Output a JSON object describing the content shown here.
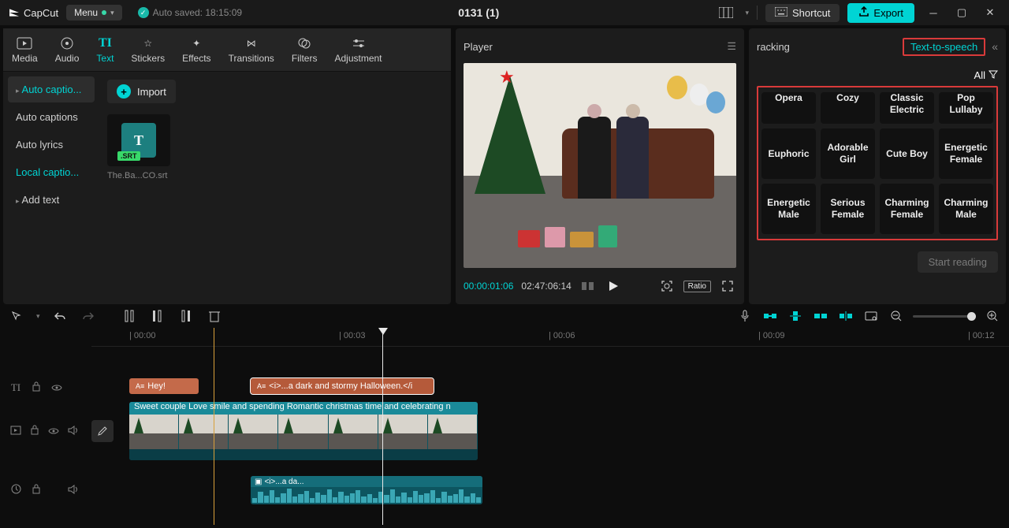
{
  "app": {
    "name": "CapCut",
    "menu_label": "Menu",
    "auto_saved": "Auto saved: 18:15:09",
    "project_title": "0131 (1)",
    "shortcut_label": "Shortcut",
    "export_label": "Export"
  },
  "tabs": {
    "media": "Media",
    "audio": "Audio",
    "text": "Text",
    "stickers": "Stickers",
    "effects": "Effects",
    "transitions": "Transitions",
    "filters": "Filters",
    "adjustment": "Adjustment",
    "active": "text"
  },
  "text_sidebar": {
    "items": [
      {
        "label": "Auto captio...",
        "mode": "selected",
        "has_caret": true
      },
      {
        "label": "Auto captions"
      },
      {
        "label": "Auto lyrics"
      },
      {
        "label": "Local captio...",
        "mode": "highlight"
      },
      {
        "label": "Add text",
        "has_caret": true
      }
    ]
  },
  "import": {
    "button": "Import",
    "file_tag": ".SRT",
    "file_name": "The.Ba...CO.srt"
  },
  "player": {
    "title": "Player",
    "current_time": "00:00:01:06",
    "total_time": "02:47:06:14",
    "ratio_label": "Ratio"
  },
  "right": {
    "tracking_label": "racking",
    "tts_label": "Text-to-speech",
    "all_label": "All",
    "voices": [
      "Opera",
      "Cozy",
      "Classic Electric",
      "Pop Lullaby",
      "Euphoric",
      "Adorable Girl",
      "Cute Boy",
      "Energetic Female",
      "Energetic Male",
      "Serious Female",
      "Charming Female",
      "Charming Male"
    ],
    "start_reading": "Start reading"
  },
  "ruler": {
    "t0": "| 00:00",
    "t1": "| 00:03",
    "t2": "| 00:06",
    "t3": "| 00:09",
    "t4": "| 00:12"
  },
  "clips": {
    "caption1": "Hey!",
    "caption2": "<i>...a dark and stormy Halloween.</i",
    "video_title": "Sweet couple Love smile and spending Romantic christmas time and celebrating n",
    "audio_title": "<i>...a da..."
  }
}
